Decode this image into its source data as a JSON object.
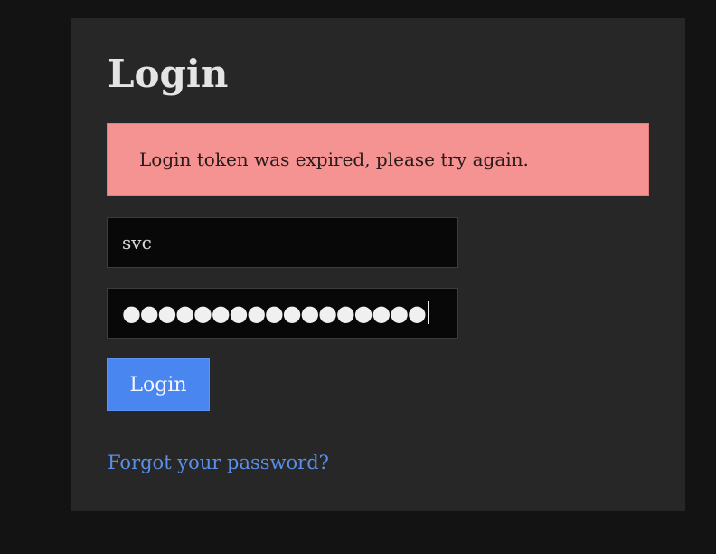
{
  "page": {
    "title": "Login"
  },
  "alert": {
    "message": "Login token was expired, please try again."
  },
  "username_field": {
    "value": "svc"
  },
  "password_field": {
    "masked_value": "●●●●●●●●●●●●●●●●●"
  },
  "login_button": {
    "label": "Login"
  },
  "forgot_link": {
    "label": "Forgot your password?"
  },
  "colors": {
    "page_background": "#131313",
    "card_background": "#272727",
    "alert_background": "#f59292",
    "button_background": "#4a86f0",
    "link_color": "#5b8fe7"
  }
}
